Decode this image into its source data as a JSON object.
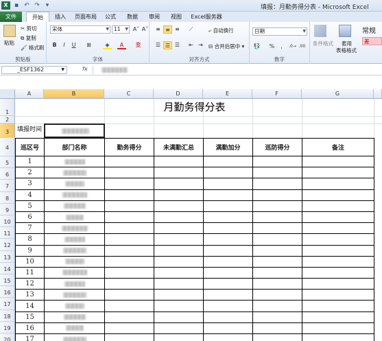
{
  "app": {
    "logo": "X",
    "title": "填报：月勤务得分表 - Microsoft Excel",
    "qat_icons": [
      "save-icon",
      "undo-icon",
      "redo-icon",
      "customize-icon"
    ]
  },
  "tabs": [
    "文件",
    "开始",
    "插入",
    "页面布局",
    "公式",
    "数据",
    "审阅",
    "视图",
    "Excel服务器"
  ],
  "ribbon": {
    "clipboard": {
      "paste": "粘贴",
      "cut": "剪切",
      "copy": "复制",
      "format_painter": "格式刷",
      "label": "剪贴板"
    },
    "font": {
      "name": "宋体",
      "size": "11",
      "bold": "B",
      "italic": "I",
      "underline": "U",
      "label": "字体",
      "grow": "A˄",
      "shrink": "A˅",
      "wen": "变"
    },
    "alignment": {
      "wrap": "自动换行",
      "merge": "合并后居中",
      "label": "对齐方式"
    },
    "number": {
      "format": "日期",
      "percent": "%",
      "comma": ",",
      "label": "数字"
    },
    "styles": {
      "conditional": "条件格式",
      "table_format_1": "套用",
      "table_format_2": "表格格式",
      "normal": "常规",
      "bad": "差"
    }
  },
  "formula_bar": {
    "name_box": "_ESF1362",
    "fx": "fx"
  },
  "columns": [
    "A",
    "B",
    "C",
    "D",
    "E",
    "F",
    "G"
  ],
  "rows": [
    "1",
    "2",
    "3",
    "4",
    "5",
    "6",
    "7",
    "8",
    "9",
    "10",
    "11",
    "12",
    "13",
    "14",
    "15",
    "16",
    "17",
    "18",
    "19",
    "20",
    "21"
  ],
  "sheet": {
    "title": "月勤务得分表",
    "fill_time_label": "填报时间",
    "headers": [
      "巡区号",
      "部门名称",
      "勤务得分",
      "未满勤汇总",
      "满勤加分",
      "巡防得分",
      "备注"
    ],
    "zone_numbers": [
      "1",
      "2",
      "3",
      "4",
      "5",
      "6",
      "7",
      "8",
      "9",
      "10",
      "11",
      "12",
      "13",
      "14",
      "15",
      "16",
      "17"
    ]
  }
}
